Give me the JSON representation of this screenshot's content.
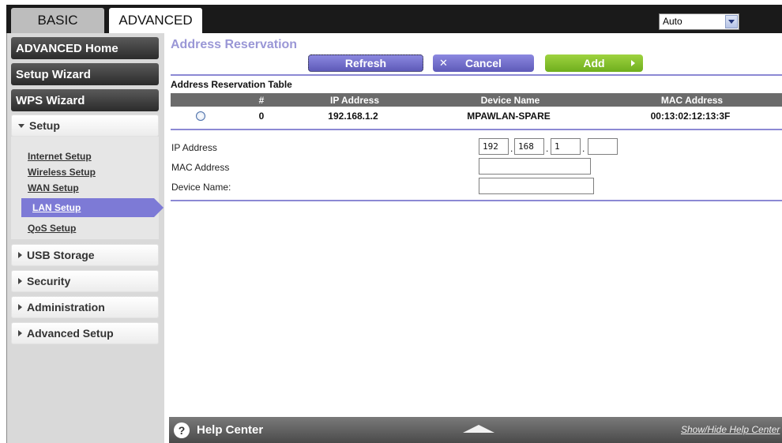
{
  "tabs": {
    "basic": "BASIC",
    "advanced": "ADVANCED"
  },
  "language": {
    "selected": "Auto"
  },
  "sidebar": {
    "advanced_home": "ADVANCED Home",
    "setup_wizard": "Setup Wizard",
    "wps_wizard": "WPS Wizard",
    "setup": "Setup",
    "setup_links": [
      "Internet Setup",
      "Wireless Setup",
      "WAN Setup",
      "LAN Setup",
      "QoS Setup"
    ],
    "usb_storage": "USB Storage",
    "security": "Security",
    "administration": "Administration",
    "advanced_setup": "Advanced Setup"
  },
  "main": {
    "title": "Address Reservation",
    "buttons": {
      "refresh": "Refresh",
      "cancel": "Cancel",
      "add": "Add"
    },
    "table_title": "Address Reservation Table",
    "columns": [
      "#",
      "IP Address",
      "Device Name",
      "MAC Address"
    ],
    "rows": [
      {
        "index": "0",
        "ip": "192.168.1.2",
        "device": "MPAWLAN-SPARE",
        "mac": "00:13:02:12:13:3F"
      }
    ],
    "form": {
      "ip_label": "IP Address",
      "mac_label": "MAC Address",
      "device_label": "Device Name:",
      "ip_octets": [
        "192",
        "168",
        "1",
        ""
      ]
    }
  },
  "help": {
    "title": "Help Center",
    "toggle": "Show/Hide Help Center"
  }
}
